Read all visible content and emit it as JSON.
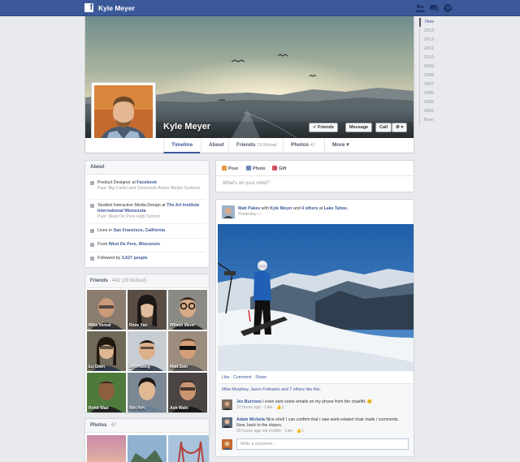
{
  "topbar": {
    "logo": "f",
    "name": "Kyle Meyer",
    "icons": [
      "friends-icon",
      "messages-icon",
      "notifications-globe-icon"
    ]
  },
  "scrubber": {
    "years": [
      "Now",
      "2013",
      "2012",
      "2011",
      "2010",
      "2009",
      "2008",
      "2007",
      "2006",
      "2005",
      "2002",
      "Born"
    ]
  },
  "profile": {
    "name": "Kyle Meyer",
    "friends_button": "✓ Friends",
    "message_button": "Message",
    "call_button": "Call",
    "settings_button": "⚙ ▾"
  },
  "nav": {
    "timeline": "Timeline",
    "about": "About",
    "friends": "Friends",
    "friends_count": "19 Mutual",
    "photos": "Photos",
    "photos_count": "47",
    "more": "More ▾"
  },
  "about": {
    "heading": "About",
    "rows": [
      {
        "line1a": "Product Designer at ",
        "line1b": "Facebook",
        "line2": "Past: Big Cartel and Clockwork Active Media Systems"
      },
      {
        "line1a": "Studied Interactive Media Design at ",
        "line1b": "The Art Institute International Minnesota",
        "line2": "Past: West De Pere High School"
      },
      {
        "line1a": "Lives in ",
        "line1b": "San Francisco, California",
        "line2": ""
      },
      {
        "line1a": "From ",
        "line1b": "West De Pere, Wisconsin",
        "line2": ""
      },
      {
        "line1a": "Followed by ",
        "line1b": "3,627 people",
        "line2": ""
      }
    ]
  },
  "friends": {
    "heading": "Friends",
    "count": " · 442 (19 Mutual)",
    "people": [
      "Mike Vernal",
      "Rose Yao",
      "Wilson Miner",
      "Lu Chen",
      "Jeff Huang",
      "Matt Sain",
      "Rohit Wad",
      "Wei Yeh",
      "Ash Wahl"
    ]
  },
  "photos": {
    "heading": "Photos",
    "count": " · 47"
  },
  "publisher": {
    "post": "Post",
    "photo": "Photo",
    "gift": "Gift",
    "placeholder": "What's on your mind?"
  },
  "post": {
    "author": "Matt Pakes",
    "with_text": " with ",
    "tagged": "Kyle Meyer",
    "and_text": " and ",
    "others": "4 others",
    "at_text": " at ",
    "place": "Lake Tahoe.",
    "time": "Yesterday",
    "actions": "Like · Comment · Share",
    "likes": "Mike Murphey, Jason Fotinatos and 7 others like this.",
    "comments": [
      {
        "author": "Jez Burrows",
        "text": " I even sent some emails on my phone from the chairlift. 😊",
        "meta": "22 hours ago · Like · 👍2"
      },
      {
        "author": "Adam Michela",
        "text": " Nice shot! I can confirm that I saw work-related chair mails / comments. Now, back to the slopes.",
        "meta": "20 hours ago via mobile · Like · 👍1"
      }
    ],
    "write_placeholder": "Write a comment..."
  },
  "colors": {
    "brand": "#3b5998",
    "background": "#e9eaed"
  }
}
